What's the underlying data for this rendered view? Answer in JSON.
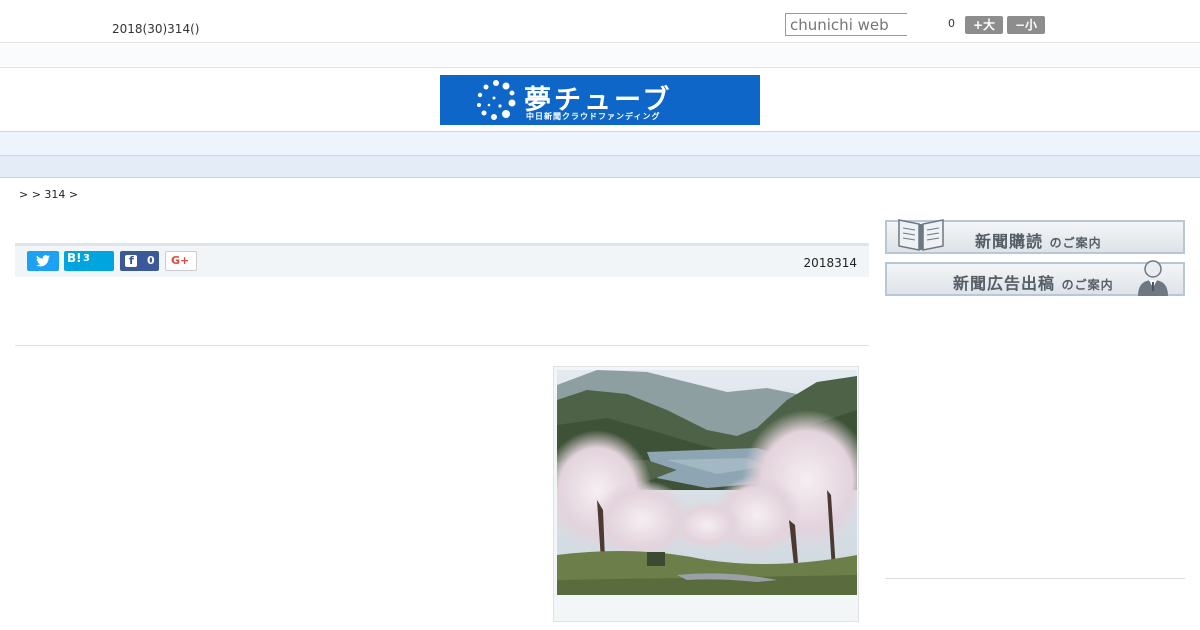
{
  "header": {
    "date": "2018(30)314()",
    "search_placeholder": "chunichi web",
    "zoom_value": "0",
    "bigger_label": "+大",
    "smaller_label": "−小"
  },
  "logo": {
    "title": "夢チューブ",
    "subtitle": "中日新聞クラウドファンディング"
  },
  "nav": {
    "items": [
      "",
      "",
      "",
      "",
      "",
      "",
      "",
      "",
      ""
    ]
  },
  "breadcrumb": ">  > 314 >",
  "share": {
    "hatena_label": "B!",
    "hatena_count": "3",
    "facebook_count": "0",
    "gplus_label": "G+"
  },
  "article": {
    "date": "2018314"
  },
  "sidebar": {
    "subscribe": {
      "main": "新聞購読",
      "suffix": "のご案内"
    },
    "advertise": {
      "main": "新聞広告出稿",
      "suffix": "のご案内"
    }
  },
  "colors": {
    "logo_bg": "#0e66c9",
    "nav_bg": "#eef4fb",
    "twitter": "#1da1f2",
    "hatena": "#00a4de",
    "facebook": "#3b5998",
    "gplus": "#dd4b39"
  }
}
